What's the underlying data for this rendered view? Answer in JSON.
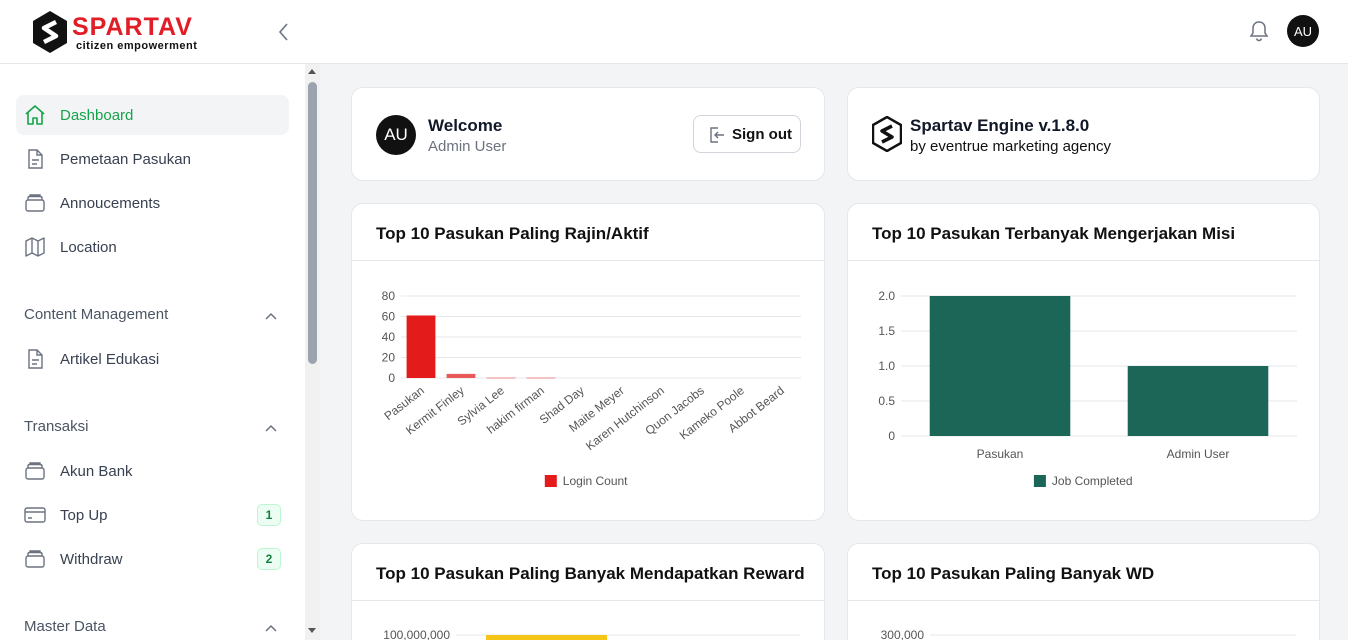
{
  "brand": {
    "name": "SPARTAV",
    "tagline": "citizen empowerment"
  },
  "header": {
    "avatar_initials": "AU",
    "icons": [
      "chevron-left-icon",
      "bell-icon"
    ]
  },
  "sidebar": {
    "items": [
      {
        "label": "Dashboard",
        "icon": "home-icon",
        "active": true
      },
      {
        "label": "Pemetaan Pasukan",
        "icon": "document-icon"
      },
      {
        "label": "Annoucements",
        "icon": "stack-icon"
      },
      {
        "label": "Location",
        "icon": "map-icon"
      }
    ],
    "sections": [
      {
        "title": "Content Management",
        "items": [
          {
            "label": "Artikel Edukasi",
            "icon": "document-icon"
          }
        ]
      },
      {
        "title": "Transaksi",
        "items": [
          {
            "label": "Akun Bank",
            "icon": "stack-icon"
          },
          {
            "label": "Top Up",
            "icon": "credit-card-icon",
            "badge": "1"
          },
          {
            "label": "Withdraw",
            "icon": "stack-icon",
            "badge": "2"
          }
        ]
      },
      {
        "title": "Master Data",
        "items": []
      }
    ]
  },
  "welcome": {
    "avatar_initials": "AU",
    "title": "Welcome",
    "user": "Admin User",
    "signout_label": "Sign out"
  },
  "engine": {
    "title": "Spartav Engine v.1.8.0",
    "subtitle": "by eventrue marketing agency"
  },
  "colors": {
    "active_green": "#16a34a",
    "chart_red": "#e31b1b",
    "chart_teal": "#1c6658",
    "chart_yellow": "#f5c518"
  },
  "chart_data": [
    {
      "type": "bar",
      "title": "Top 10 Pasukan Paling Rajin/Aktif",
      "categories": [
        "Pasukan",
        "Kermit Finley",
        "Sylvia Lee",
        "hakim firman",
        "Shad Day",
        "Maite Meyer",
        "Karen Hutchinson",
        "Quon Jacobs",
        "Kameko Poole",
        "Abbot Beard"
      ],
      "series": [
        {
          "name": "Login Count",
          "values": [
            61,
            4,
            1,
            1,
            0,
            0,
            0,
            0,
            0,
            0
          ]
        }
      ],
      "yticks": [
        "0",
        "20",
        "40",
        "60",
        "80"
      ],
      "ylim": [
        0,
        80
      ],
      "grid": true,
      "legend": "bottom"
    },
    {
      "type": "bar",
      "title": "Top 10 Pasukan Terbanyak Mengerjakan Misi",
      "categories": [
        "Pasukan",
        "Admin User"
      ],
      "series": [
        {
          "name": "Job Completed",
          "values": [
            2,
            1
          ]
        }
      ],
      "yticks": [
        "0",
        "0.5",
        "1.0",
        "1.5",
        "2.0"
      ],
      "ylim": [
        0,
        2
      ],
      "grid": true,
      "legend": "bottom"
    },
    {
      "type": "bar",
      "title": "Top 10 Pasukan Paling Banyak Mendapatkan Reward",
      "yticks": [
        "100,000,000"
      ],
      "grid": true
    },
    {
      "type": "bar",
      "title": "Top 10 Pasukan Paling Banyak WD",
      "yticks": [
        "300,000"
      ],
      "grid": true
    }
  ]
}
